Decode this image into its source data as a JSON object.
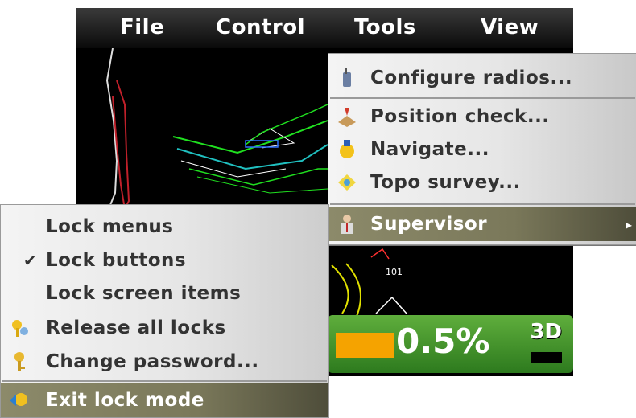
{
  "menubar": {
    "items": [
      {
        "label": "File"
      },
      {
        "label": "Control"
      },
      {
        "label": "Tools"
      },
      {
        "label": "View"
      }
    ]
  },
  "canvas": {
    "point_label": "101"
  },
  "tools_menu": {
    "items": [
      {
        "label": "Configure radios...",
        "icon": "radio-icon"
      },
      {
        "label": "Position check...",
        "icon": "position-check-icon"
      },
      {
        "label": "Navigate...",
        "icon": "navigate-icon"
      },
      {
        "label": "Topo survey...",
        "icon": "topo-survey-icon"
      },
      {
        "label": "Supervisor",
        "icon": "supervisor-icon",
        "highlighted": true
      }
    ]
  },
  "lock_menu": {
    "items": [
      {
        "label": "Lock menus",
        "checked": false
      },
      {
        "label": "Lock buttons",
        "checked": true
      },
      {
        "label": "Lock screen items",
        "checked": false
      },
      {
        "label": "Release all locks",
        "icon": "release-locks-icon"
      },
      {
        "label": "Change password...",
        "icon": "key-icon"
      },
      {
        "label": "Exit lock mode",
        "icon": "exit-lock-icon",
        "highlighted": true
      }
    ]
  },
  "status": {
    "percent": "0.5%",
    "mode": "3D",
    "accent": "#f5a300",
    "panel_color": "#3f8e2a"
  }
}
